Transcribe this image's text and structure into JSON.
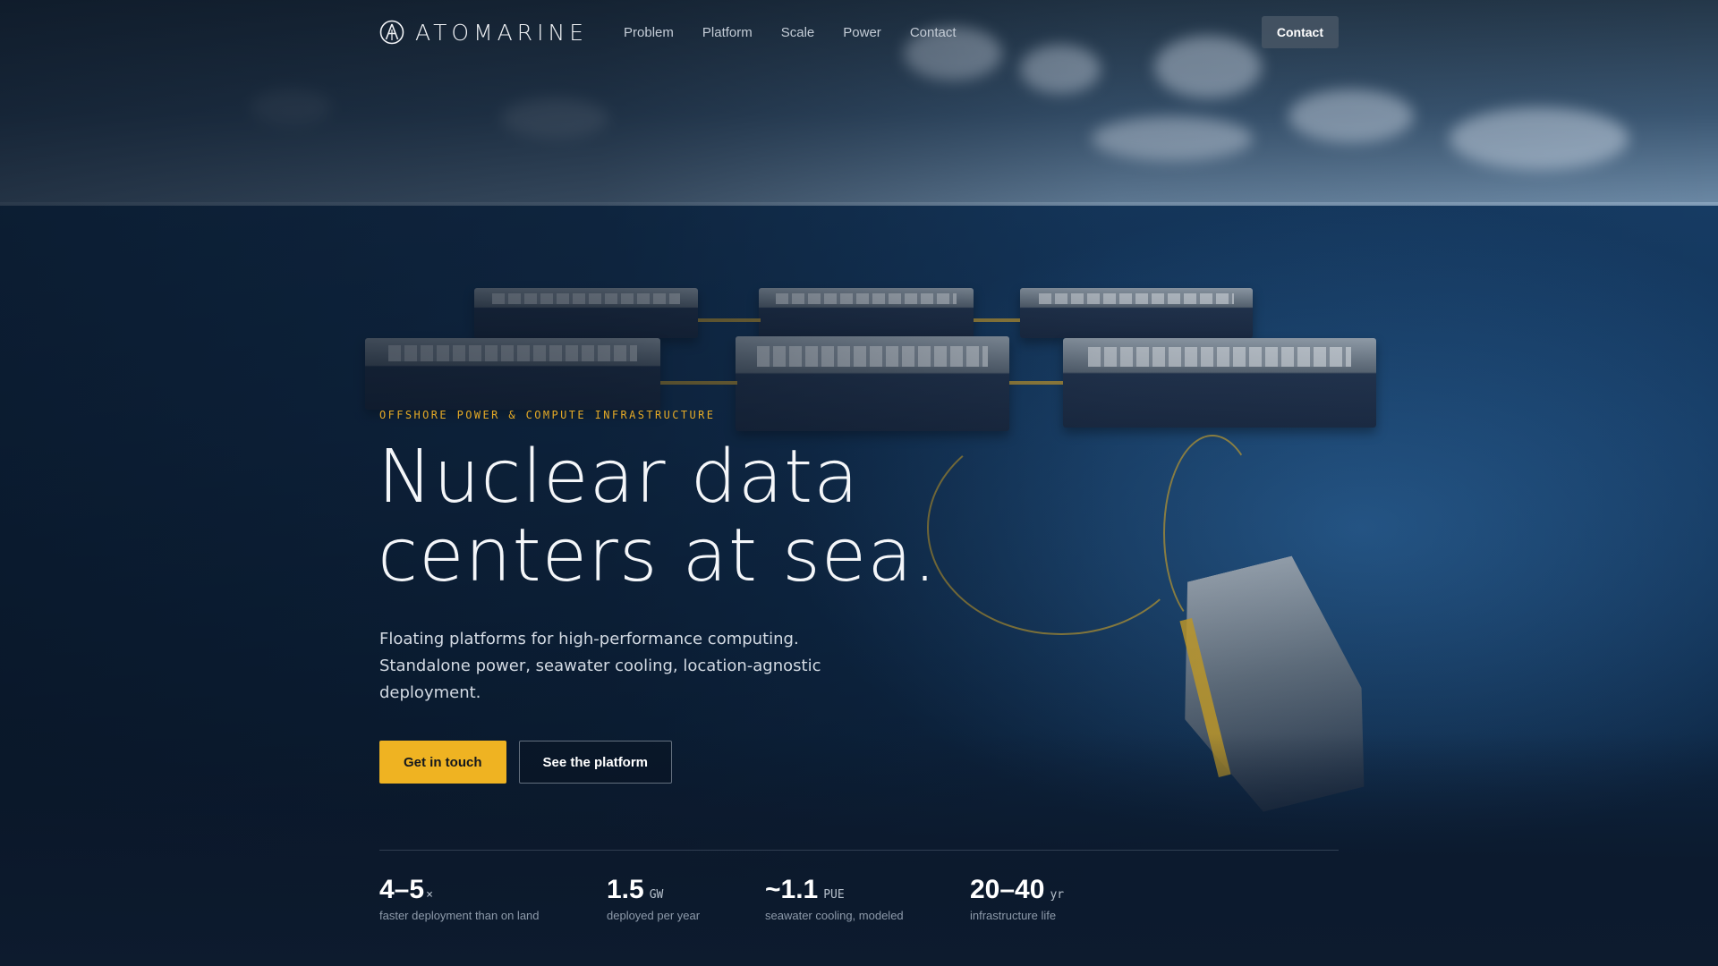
{
  "brand": {
    "name": "ATOMARINE",
    "logo_icon": "atom-logo-icon"
  },
  "nav": {
    "links": [
      "Problem",
      "Platform",
      "Scale",
      "Power",
      "Contact"
    ],
    "cta_label": "Contact"
  },
  "hero": {
    "eyebrow": "OFFSHORE POWER & COMPUTE INFRASTRUCTURE",
    "headline_line1": "Nuclear data",
    "headline_line2": "centers at sea.",
    "subcopy": "Floating platforms for high-performance computing. Standalone power, seawater cooling, location-agnostic deployment.",
    "primary_cta": "Get in touch",
    "secondary_cta": "See the platform"
  },
  "stats": [
    {
      "value": "4–5",
      "unit": "×",
      "label": "faster deployment than on land"
    },
    {
      "value": "1.5",
      "unit": "GW",
      "label": "deployed per year"
    },
    {
      "value": "~1.1",
      "unit": "PUE",
      "label": "seawater cooling, modeled"
    },
    {
      "value": "20–40",
      "unit": "yr",
      "label": "infrastructure life"
    }
  ],
  "colors": {
    "accent": "#efb322",
    "eyebrow": "#e5aa26",
    "background": "#0d1b2e"
  }
}
